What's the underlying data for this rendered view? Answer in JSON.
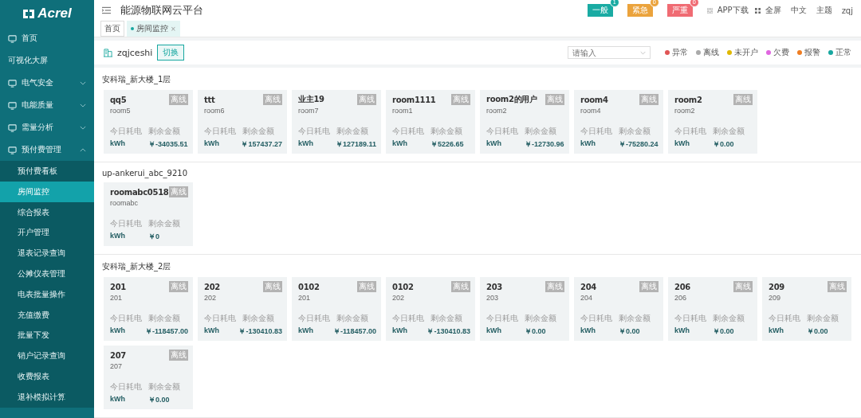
{
  "logo": "Acrel",
  "sidebar": {
    "items": [
      {
        "label": "首页",
        "selected": false
      },
      {
        "label": "可视化大屏",
        "selected": false
      },
      {
        "label": "电气安全",
        "expanded": false,
        "selected": false
      },
      {
        "label": "电能质量",
        "expanded": false,
        "selected": false
      },
      {
        "label": "需量分析",
        "expanded": false,
        "selected": false
      },
      {
        "label": "预付费管理",
        "expanded": true,
        "selected": false,
        "children": [
          {
            "label": "预付费看板",
            "selected": false
          },
          {
            "label": "房间监控",
            "selected": true
          },
          {
            "label": "综合报表",
            "selected": false
          },
          {
            "label": "开户管理",
            "selected": false
          },
          {
            "label": "退表记录查询",
            "selected": false
          },
          {
            "label": "公摊仪表管理",
            "selected": false
          },
          {
            "label": "电表批量操作",
            "selected": false
          },
          {
            "label": "充值缴费",
            "selected": false
          },
          {
            "label": "批量下发",
            "selected": false
          },
          {
            "label": "销户记录查询",
            "selected": false
          },
          {
            "label": "收费报表",
            "selected": false
          },
          {
            "label": "退补模拟计算",
            "selected": false
          }
        ]
      }
    ]
  },
  "header": {
    "title": "能源物联网云平台",
    "alerts": [
      {
        "label": "一般",
        "count": "1",
        "color": "#1aaba3"
      },
      {
        "label": "紧急",
        "count": "0",
        "color": "#eba33c"
      },
      {
        "label": "严重",
        "count": "0",
        "color": "#f06b73"
      }
    ],
    "links": [
      "APP下载",
      "全屏",
      "中文",
      "主题",
      "zqj"
    ]
  },
  "tabs": [
    {
      "label": "首页",
      "selected": false
    },
    {
      "label": "房间监控",
      "selected": true,
      "close": "×"
    }
  ],
  "project": {
    "name": "zqjceshi",
    "switch_button": "切换"
  },
  "search": {
    "placeholder": "请输入"
  },
  "legend": [
    {
      "label": "异常",
      "color": "#e05555"
    },
    {
      "label": "离线",
      "color": "#aaaaaa"
    },
    {
      "label": "未开户",
      "color": "#e0b800"
    },
    {
      "label": "欠费",
      "color": "#e066e0"
    },
    {
      "label": "报警",
      "color": "#ef7d22"
    },
    {
      "label": "正常",
      "color": "#17a7a0"
    }
  ],
  "groups": [
    {
      "title": "安科瑞_新大楼_1层",
      "rooms": [
        {
          "name": "qq5",
          "room": "room5",
          "status": "离线",
          "energy_label": "今日耗电",
          "balance_label": "剩余金额",
          "energy": "kWh",
          "balance": "￥-34035.51"
        },
        {
          "name": "ttt",
          "room": "room6",
          "status": "离线",
          "energy_label": "今日耗电",
          "balance_label": "剩余金额",
          "energy": "kWh",
          "balance": "￥157437.27"
        },
        {
          "name": "业主19",
          "room": "room7",
          "status": "离线",
          "energy_label": "今日耗电",
          "balance_label": "剩余金额",
          "energy": "kWh",
          "balance": "￥127189.11"
        },
        {
          "name": "room1111",
          "room": "room1",
          "status": "离线",
          "energy_label": "今日耗电",
          "balance_label": "剩余金额",
          "energy": "kWh",
          "balance": "￥5226.65"
        },
        {
          "name": "room2的用户",
          "room": "room2",
          "status": "离线",
          "energy_label": "今日耗电",
          "balance_label": "剩余金额",
          "energy": "kWh",
          "balance": "￥-12730.96"
        },
        {
          "name": "room4",
          "room": "room4",
          "status": "离线",
          "energy_label": "今日耗电",
          "balance_label": "剩余金额",
          "energy": "kWh",
          "balance": "￥-75280.24"
        },
        {
          "name": "room2",
          "room": "room2",
          "status": "离线",
          "energy_label": "今日耗电",
          "balance_label": "剩余金额",
          "energy": "kWh",
          "balance": "￥0.00"
        }
      ]
    },
    {
      "title": "up-ankerui_abc_9210",
      "rooms": [
        {
          "name": "roomabc0518",
          "room": "roomabc",
          "status": "离线",
          "energy_label": "今日耗电",
          "balance_label": "剩余金额",
          "energy": "kWh",
          "balance": "￥0"
        }
      ]
    },
    {
      "title": "安科瑞_新大楼_2层",
      "rooms": [
        {
          "name": "201",
          "room": "201",
          "status": "离线",
          "energy_label": "今日耗电",
          "balance_label": "剩余金额",
          "energy": "kWh",
          "balance": "￥-118457.00"
        },
        {
          "name": "202",
          "room": "202",
          "status": "离线",
          "energy_label": "今日耗电",
          "balance_label": "剩余金额",
          "energy": "kWh",
          "balance": "￥-130410.83"
        },
        {
          "name": "0102",
          "room": "201",
          "status": "离线",
          "energy_label": "今日耗电",
          "balance_label": "剩余金额",
          "energy": "kWh",
          "balance": "￥-118457.00"
        },
        {
          "name": "0102",
          "room": "202",
          "status": "离线",
          "energy_label": "今日耗电",
          "balance_label": "剩余金额",
          "energy": "kWh",
          "balance": "￥-130410.83"
        },
        {
          "name": "203",
          "room": "203",
          "status": "离线",
          "energy_label": "今日耗电",
          "balance_label": "剩余金额",
          "energy": "kWh",
          "balance": "￥0.00"
        },
        {
          "name": "204",
          "room": "204",
          "status": "离线",
          "energy_label": "今日耗电",
          "balance_label": "剩余金额",
          "energy": "kWh",
          "balance": "￥0.00"
        },
        {
          "name": "206",
          "room": "206",
          "status": "离线",
          "energy_label": "今日耗电",
          "balance_label": "剩余金额",
          "energy": "kWh",
          "balance": "￥0.00"
        },
        {
          "name": "209",
          "room": "209",
          "status": "离线",
          "energy_label": "今日耗电",
          "balance_label": "剩余金额",
          "energy": "kWh",
          "balance": "￥0.00"
        },
        {
          "name": "207",
          "room": "207",
          "status": "离线",
          "energy_label": "今日耗电",
          "balance_label": "剩余金额",
          "energy": "kWh",
          "balance": "￥0.00"
        }
      ]
    }
  ]
}
